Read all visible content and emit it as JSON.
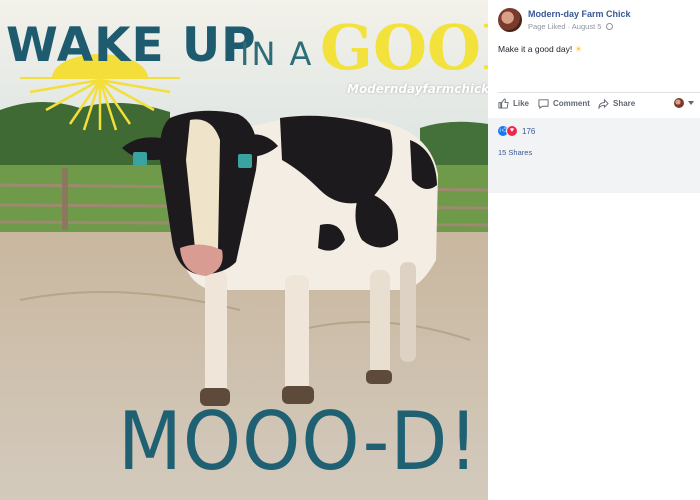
{
  "photo": {
    "text_line1": "WAKE UP",
    "text_line2": "IN A",
    "text_line3": "GOOD",
    "handle": "Moderndayfarmchick",
    "text_bottom": "MOOO-D!"
  },
  "post": {
    "page_name": "Modern-day Farm Chick",
    "status": "Page Liked",
    "separator": "·",
    "date": "August 5",
    "text": "Make it a good day!",
    "emoji": "☀"
  },
  "actions": {
    "like_label": "Like",
    "comment_label": "Comment",
    "share_label": "Share"
  },
  "reactions": {
    "count": "176",
    "shares": "15 Shares"
  },
  "colors": {
    "link_blue": "#385898",
    "title_teal": "#1f5b6e",
    "good_yellow": "#f2e23b"
  }
}
